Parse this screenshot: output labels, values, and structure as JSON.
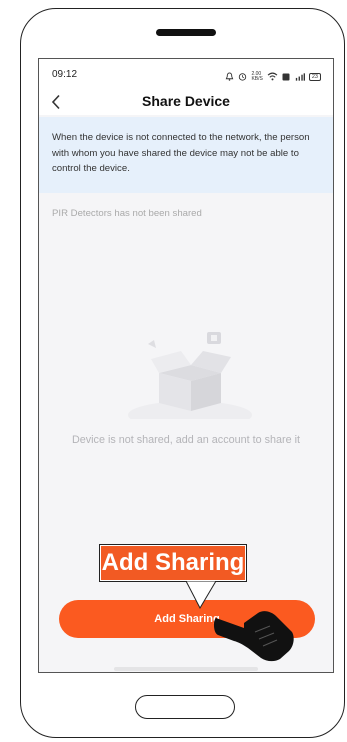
{
  "status_bar": {
    "time": "09:12",
    "network_speed": "2.00\nKB/S",
    "battery": "23"
  },
  "header": {
    "back_icon": "chevron-left-icon",
    "title": "Share Device"
  },
  "notice": {
    "text": "When the device is not connected to the network, the person with whom you have shared the device may not be able to control the device."
  },
  "share_status": "PIR Detectors has not been shared",
  "empty_state": {
    "icon": "empty-box-icon",
    "text": "Device is not shared, add an account to share it"
  },
  "primary_button": {
    "label": "Add Sharing",
    "color": "#fb5a20"
  },
  "annotation": {
    "callout": "Add Sharing",
    "color": "#f25a23",
    "pointer_icon": "pointing-hand-icon"
  }
}
